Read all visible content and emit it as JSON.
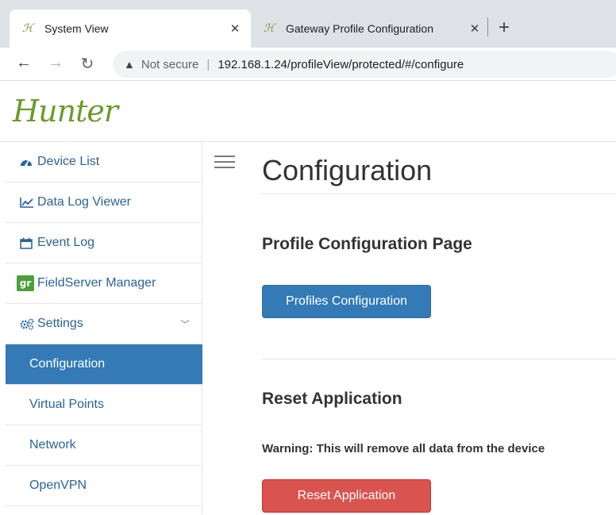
{
  "browser": {
    "tabs": [
      {
        "title": "System View",
        "active": true
      },
      {
        "title": "Gateway Profile Configuration",
        "active": false
      }
    ],
    "new_tab_label": "+",
    "address": {
      "security_label": "Not secure",
      "url": "192.168.1.24/profileView/protected/#/configure"
    }
  },
  "app": {
    "logo_text": "Hunter",
    "brand_color": "#6a9c2c"
  },
  "sidebar": {
    "items": [
      {
        "label": "Device List",
        "icon": "dashboard-icon"
      },
      {
        "label": "Data Log Viewer",
        "icon": "line-chart-icon"
      },
      {
        "label": "Event Log",
        "icon": "calendar-icon"
      },
      {
        "label": "FieldServer Manager",
        "icon": "gr-logo-icon",
        "badge": "gr"
      },
      {
        "label": "Settings",
        "icon": "gears-icon",
        "expanded": true
      }
    ],
    "sub_items": [
      {
        "label": "Configuration",
        "active": true
      },
      {
        "label": "Virtual Points",
        "active": false
      },
      {
        "label": "Network",
        "active": false
      },
      {
        "label": "OpenVPN",
        "active": false
      }
    ]
  },
  "main": {
    "title": "Configuration",
    "profile_section": {
      "title": "Profile Configuration Page",
      "button_label": "Profiles Configuration"
    },
    "reset_section": {
      "title": "Reset Application",
      "warning": "Warning: This will remove all data from the device",
      "button_label": "Reset Application"
    }
  },
  "colors": {
    "primary": "#337ab7",
    "danger": "#d9534f",
    "link": "#2a6496"
  }
}
